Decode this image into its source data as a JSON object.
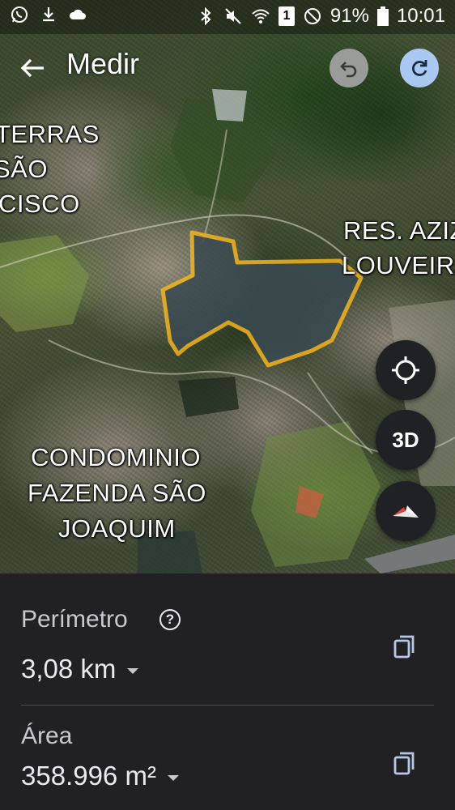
{
  "status_bar": {
    "battery": "91%",
    "time": "10:01",
    "sim": "1"
  },
  "top_bar": {
    "title": "Medir"
  },
  "map": {
    "labels": {
      "left_line1": "TERRAS",
      "left_line2": "SÃO",
      "left_line3": "CISCO",
      "right_line1": "RES. AZIZ",
      "right_line2": "LOUVEIRA",
      "bottom_line1": "CONDOMINIO",
      "bottom_line2": "FAZENDA SÃO",
      "bottom_line3": "JOAQUIM"
    },
    "outline_color": "#f2b420",
    "button_3d": "3D"
  },
  "measure": {
    "perimeter_label": "Perímetro",
    "perimeter_value": "3,08 km",
    "area_label": "Área",
    "area_value": "358.996 m²",
    "help_symbol": "?"
  },
  "icons": {
    "status": [
      "whatsapp-icon",
      "download-icon",
      "cloud-icon",
      "bluetooth-icon",
      "mute-icon",
      "wifi-icon",
      "sim-icon",
      "block-icon",
      "battery-icon"
    ],
    "top": [
      "back-arrow-icon",
      "undo-icon",
      "redo-icon"
    ],
    "map": [
      "my-location-icon",
      "compass-icon"
    ],
    "sheet": [
      "help-icon",
      "copy-icon"
    ]
  }
}
